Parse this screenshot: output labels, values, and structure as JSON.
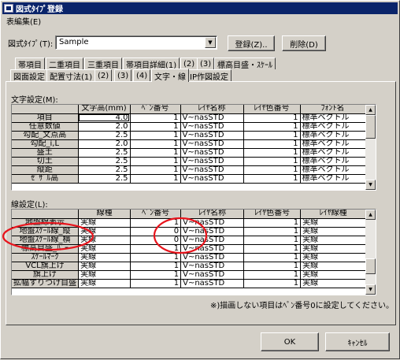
{
  "window": {
    "title": "図式ﾀｲﾌﾟ登録"
  },
  "menu": {
    "items": [
      "表編集(E)"
    ]
  },
  "header": {
    "zushiki_type_label": "図式ﾀｲﾌﾟ(T):",
    "zushiki_type_value": "Sample",
    "register_label": "登録(Z)..",
    "delete_label": "削除(D)"
  },
  "tabs_row1": [
    "帯項目",
    "二重項目",
    "三重項目",
    "帯項目詳細(1)",
    "(2)",
    "(3)",
    "標高目盛・ｽｹｰﾙ"
  ],
  "tabs_row2": [
    "図面設定",
    "配置寸法(1)",
    "(2)",
    "(3)",
    "(4)",
    "文字・線",
    "IP作図設定"
  ],
  "active_tab": "文字・線",
  "text_settings": {
    "label": "文字設定(M):",
    "columns": [
      "",
      "文字高(mm)",
      "ﾍﾟﾝ番号",
      "ﾚｲﾔ名称",
      "ﾚｲﾔ色番号",
      "ﾌｫﾝﾄ名"
    ],
    "rows": [
      [
        "項目",
        "4.0",
        "1",
        "V~nasSTD",
        "1",
        "標準ベクトル"
      ],
      [
        "任意数値",
        "2.0",
        "1",
        "V~nasSTD",
        "1",
        "標準ベクトル"
      ],
      [
        "勾配_文点高",
        "2.5",
        "1",
        "V~nasSTD",
        "1",
        "標準ベクトル"
      ],
      [
        "勾配_i,L",
        "2.0",
        "1",
        "V~nasSTD",
        "1",
        "標準ベクトル"
      ],
      [
        "盛土",
        "2.5",
        "1",
        "V~nasSTD",
        "1",
        "標準ベクトル"
      ],
      [
        "切土",
        "2.5",
        "1",
        "V~nasSTD",
        "1",
        "標準ベクトル"
      ],
      [
        "縦距",
        "2.5",
        "1",
        "V~nasSTD",
        "1",
        "標準ベクトル"
      ],
      [
        "ｾﾞｻﾞﾙ高",
        "2.5",
        "1",
        "V~nasSTD",
        "1",
        "標準ベクトル"
      ]
    ]
  },
  "line_settings": {
    "label": "線設定(L):",
    "columns": [
      "",
      "線種",
      "ﾍﾟﾝ番号",
      "ﾚｲﾔ名称",
      "ﾚｲﾔ色番号",
      "ﾚｲﾔ線種"
    ],
    "rows": [
      [
        "地盤線表示",
        "実線",
        "1",
        "V~nasSTD",
        "1",
        "実線"
      ],
      [
        "地盤ｽｹｰﾙ線_縦",
        "実線",
        "0",
        "V~nasSTD",
        "1",
        "実線"
      ],
      [
        "地盤ｽｹｰﾙ線_横",
        "実線",
        "0",
        "V~nasSTD",
        "1",
        "実線"
      ],
      [
        "標高目盛_ﾊﾞｰ",
        "実線",
        "1",
        "V~nasSTD",
        "1",
        "実線"
      ],
      [
        "ｽｹｰﾙﾏｰｸ",
        "実線",
        "1",
        "V~nasSTD",
        "1",
        "実線"
      ],
      [
        "VCL旗上げ",
        "実線",
        "1",
        "V~nasSTD",
        "1",
        "実線"
      ],
      [
        "旗上げ",
        "実線",
        "1",
        "V~nasSTD",
        "1",
        "実線"
      ],
      [
        "拡幅すりつけ目盛",
        "実線",
        "1",
        "V~nasSTD",
        "1",
        "実線"
      ]
    ],
    "note": "※)描画しない項目はﾍﾟﾝ番号0に設定してください。"
  },
  "footer": {
    "ok_label": "OK",
    "cancel_label": "ｷｬﾝｾﾙ"
  },
  "colors": {
    "annotation": "#e8141c",
    "titlebar": "#0a246a"
  }
}
